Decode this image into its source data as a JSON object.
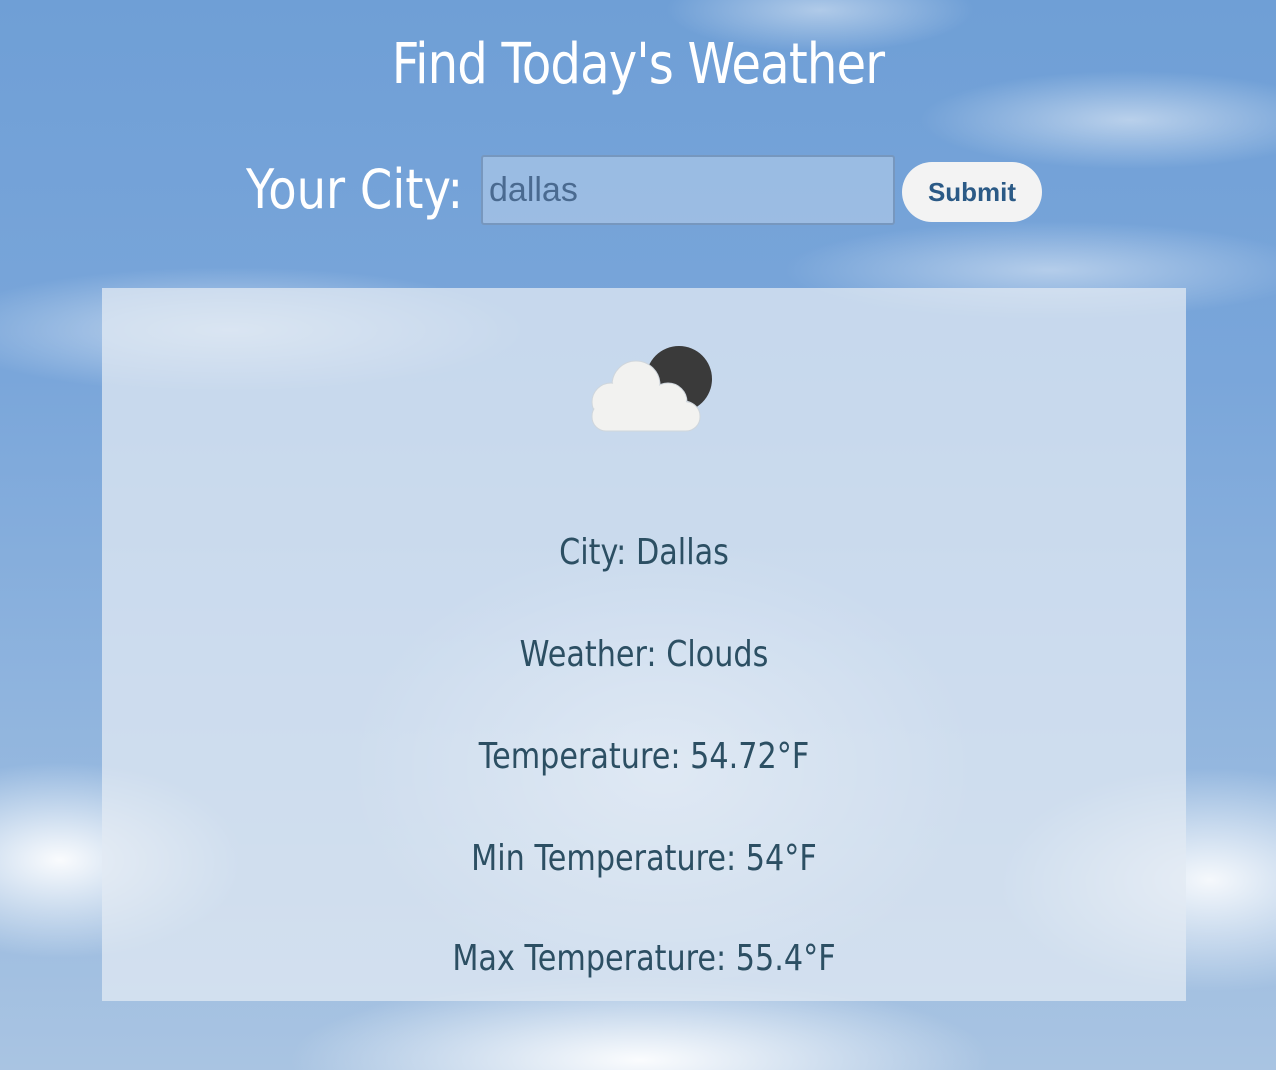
{
  "header": {
    "title": "Find Today's Weather"
  },
  "search": {
    "label": "Your City:",
    "value": "dallas",
    "submit_label": "Submit"
  },
  "result": {
    "icon": "partly-cloudy-night-icon",
    "city": "City: Dallas",
    "weather": "Weather: Clouds",
    "temperature": "Temperature: 54.72°F",
    "min_temperature": "Min Temperature: 54°F",
    "max_temperature": "Max Temperature: 55.4°F"
  },
  "colors": {
    "sky": "#7aa6da",
    "title_text": "#ffffff",
    "result_text": "#2c4f63",
    "button_text": "#2b5a86",
    "button_bg": "#f3f3f3"
  }
}
